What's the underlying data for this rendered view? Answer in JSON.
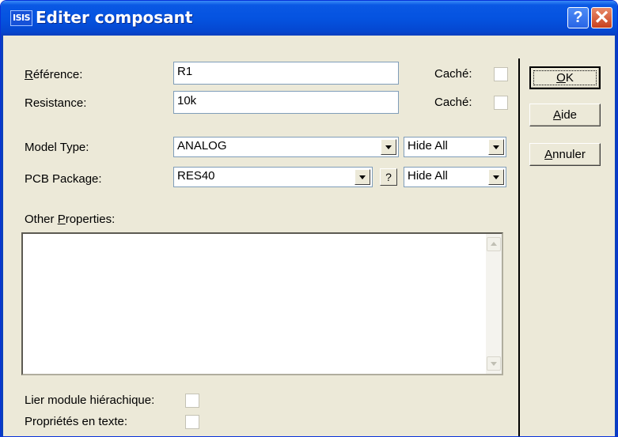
{
  "window": {
    "title": "Editer composant",
    "app_icon": "ISIS",
    "help_glyph": "?",
    "close_glyph": "✕"
  },
  "fields": {
    "reference": {
      "label_u": "R",
      "label_rest": "éférence:",
      "value": "R1",
      "hidden_label": "Caché:"
    },
    "resistance": {
      "label": "Resistance:",
      "value": "10k",
      "hidden_label": "Caché:"
    },
    "model_type": {
      "label": "Model Type:",
      "value": "ANALOG",
      "visibility": "Hide All"
    },
    "pcb_package": {
      "label": "PCB Package:",
      "value": "RES40",
      "browse_label": "?",
      "visibility": "Hide All"
    },
    "other_properties": {
      "label_pre": "Other ",
      "label_u": "P",
      "label_rest": "roperties:",
      "value": ""
    }
  },
  "options": {
    "link_module": {
      "label": "Lier module hiérachique:",
      "checked": false
    },
    "text_props": {
      "label": "Propriétés en texte:",
      "checked": false
    }
  },
  "buttons": {
    "ok": {
      "u": "O",
      "rest": "K"
    },
    "help": {
      "u": "A",
      "rest": "ide"
    },
    "cancel": {
      "u": "A",
      "rest": "nnuler"
    }
  }
}
